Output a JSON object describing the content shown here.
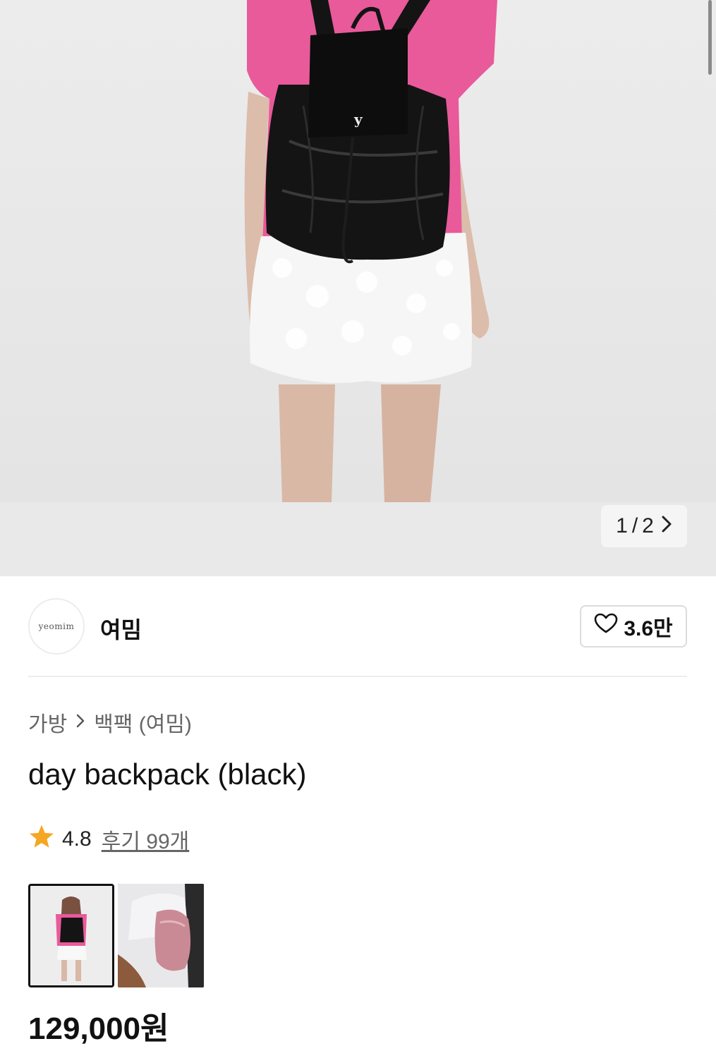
{
  "gallery": {
    "page_current": "1",
    "page_sep": "/",
    "page_total": "2",
    "next_icon": "chevron-right-icon"
  },
  "brand": {
    "logo_text": "yeomim",
    "name": "여밈",
    "like_count": "3.6만",
    "like_icon": "heart-outline-icon"
  },
  "breadcrumb": {
    "category": "가방",
    "subcategory": "백팩 (여밈)"
  },
  "product": {
    "title": "day backpack (black)",
    "rating": "4.8",
    "reviews_label": "후기 99개",
    "price": "129,000원"
  },
  "colors": {
    "star": "#f5a623",
    "shirt_pink": "#e95a9a",
    "bag_black": "#141414"
  }
}
